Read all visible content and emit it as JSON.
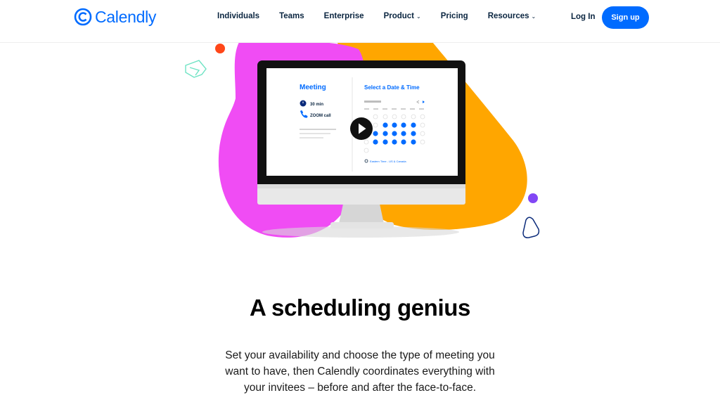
{
  "nav": {
    "logo_text": "Calendly",
    "items": [
      {
        "label": "Individuals",
        "has_dropdown": false
      },
      {
        "label": "Teams",
        "has_dropdown": false
      },
      {
        "label": "Enterprise",
        "has_dropdown": false
      },
      {
        "label": "Product",
        "has_dropdown": true
      },
      {
        "label": "Pricing",
        "has_dropdown": false
      },
      {
        "label": "Resources",
        "has_dropdown": true
      }
    ],
    "login_label": "Log In",
    "signup_label": "Sign up"
  },
  "monitor": {
    "meeting_title": "Meeting",
    "duration": "30 min",
    "location": "ZOOM call",
    "picker_title": "Select a Date & Time",
    "timezone": "Eastern Time - US & Canada"
  },
  "hero": {
    "headline": "A scheduling genius",
    "subtext_lines": [
      "Set your availability and choose the type of meeting you",
      "want to have, then Calendly coordinates everything with",
      "your invitees – before and after the face-to-face."
    ]
  },
  "colors": {
    "brand_blue": "#006bff",
    "magenta": "#f04cf4",
    "orange": "#ffa600",
    "dot_red": "#ff4719",
    "dot_purple": "#8247f5"
  },
  "icons": [
    "calendly-logo-icon",
    "chevron-down-icon",
    "clock-icon",
    "phone-icon",
    "play-icon",
    "globe-icon"
  ]
}
